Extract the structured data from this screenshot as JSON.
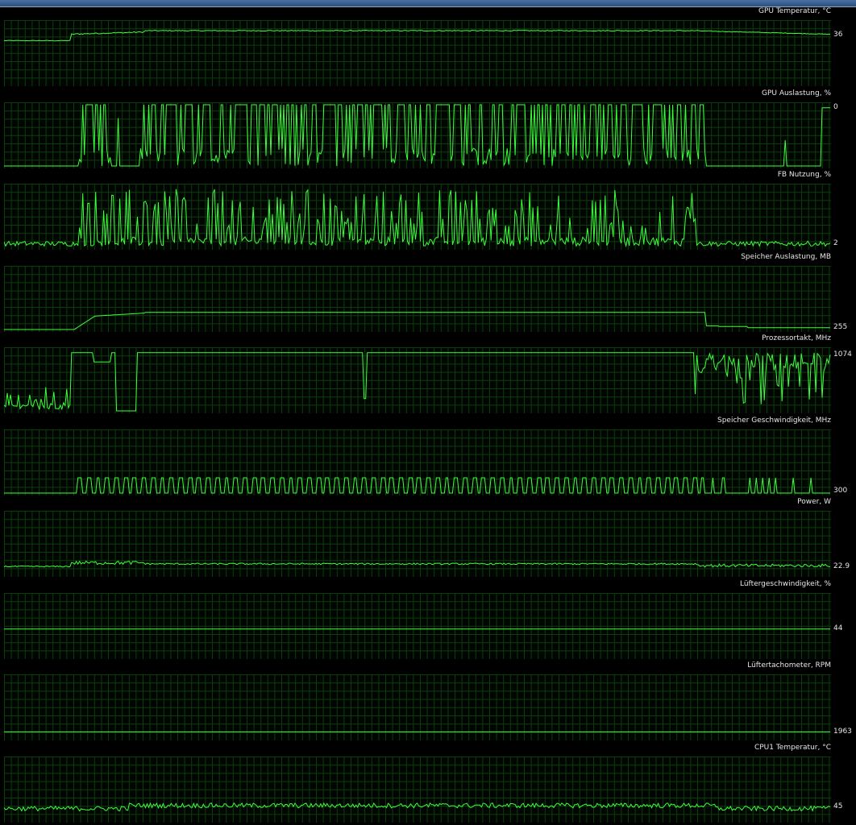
{
  "colors": {
    "background": "#000000",
    "grid": "#0d3d0d",
    "trace": "#3cff3c",
    "text": "#e6e6e6"
  },
  "graphs": [
    {
      "id": "gpu-temp",
      "title": "GPU Temperatur, °C",
      "current": "36",
      "pattern": "temp",
      "levels": {
        "start": 0.7,
        "ramp": 0.8,
        "plateau": 0.86,
        "end": 0.8
      }
    },
    {
      "id": "gpu-load",
      "title": "GPU Auslastung, %",
      "current": "0",
      "pattern": "bursts",
      "levels": {
        "base": 0.0,
        "high": 1.0
      }
    },
    {
      "id": "fb-usage",
      "title": "FB Nutzung, %",
      "current": "2",
      "pattern": "spiky",
      "levels": {
        "base": 0.02,
        "high": 0.95
      }
    },
    {
      "id": "mem-load",
      "title": "Speicher Auslastung, MB",
      "current": "255",
      "pattern": "step",
      "levels": {
        "start": 0.0,
        "mid": 0.22,
        "plateau": 0.28,
        "end": 0.03
      }
    },
    {
      "id": "core-clock",
      "title": "Prozessortakt, MHz",
      "current": "1074",
      "pattern": "clock",
      "levels": {
        "low": 0.0,
        "high": 0.95
      }
    },
    {
      "id": "mem-clock",
      "title": "Speicher Geschwindigkeit, MHz",
      "current": "300",
      "pattern": "square",
      "levels": {
        "low": 0.0,
        "high": 0.25
      }
    },
    {
      "id": "power",
      "title": "Power, W",
      "current": "22.9",
      "pattern": "power",
      "levels": {
        "base": 0.12,
        "mid": 0.16,
        "peak": 0.22
      }
    },
    {
      "id": "fan-speed",
      "title": "Lüftergeschwindigkeit, %",
      "current": "44",
      "pattern": "flat",
      "levels": {
        "base": 0.45
      }
    },
    {
      "id": "fan-rpm",
      "title": "Lüftertachometer, RPM",
      "current": "1963",
      "pattern": "flat",
      "levels": {
        "base": 0.1
      }
    },
    {
      "id": "cpu-temp",
      "title": "CPU1 Temperatur, °C",
      "current": "45",
      "pattern": "noise",
      "levels": {
        "base": 0.15,
        "amp": 0.08
      }
    }
  ]
}
